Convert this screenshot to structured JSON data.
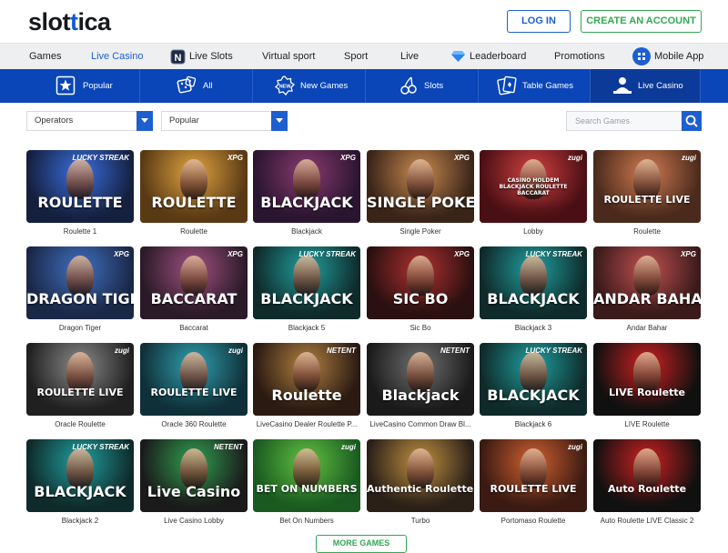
{
  "header": {
    "logo_prefix": "slot",
    "logo_accent": "t",
    "logo_suffix": "ica",
    "login_label": "LOG IN",
    "create_account_label": "CREATE AN ACCOUNT"
  },
  "main_nav": [
    {
      "label": "Games",
      "icon": null,
      "active": false
    },
    {
      "label": "Live Casino",
      "icon": null,
      "active": true
    },
    {
      "label": "Live Slots",
      "icon": "n-badge-icon",
      "active": false
    },
    {
      "label": "Virtual sport",
      "icon": null,
      "active": false
    },
    {
      "label": "Sport",
      "icon": null,
      "active": false
    },
    {
      "label": "Live",
      "icon": null,
      "active": false
    },
    {
      "label": "Leaderboard",
      "icon": "diamond-icon",
      "active": false
    },
    {
      "label": "Promotions",
      "icon": null,
      "active": false
    },
    {
      "label": "Mobile App",
      "icon": "app-icon",
      "active": false
    }
  ],
  "sub_nav": [
    {
      "label": "Popular",
      "icon": "star-icon",
      "active": false
    },
    {
      "label": "All",
      "icon": "dice-icon",
      "active": false
    },
    {
      "label": "New Games",
      "icon": "new-badge-icon",
      "active": false
    },
    {
      "label": "Slots",
      "icon": "cherries-icon",
      "active": false
    },
    {
      "label": "Table Games",
      "icon": "cards-icon",
      "active": false
    },
    {
      "label": "Live Casino",
      "icon": "dealer-icon",
      "active": true
    }
  ],
  "filters": {
    "operators_label": "Operators",
    "sort_label": "Popular",
    "search_placeholder": "Search Games"
  },
  "games": [
    {
      "name": "Roulette 1",
      "title": "ROULETTE",
      "badge": "LUCKY STREAK",
      "bg": "#15203f",
      "accent": "#3a6fe0"
    },
    {
      "name": "Roulette",
      "title": "ROULETTE",
      "badge": "XPG",
      "bg": "#5a3a14",
      "accent": "#e0a440"
    },
    {
      "name": "Blackjack",
      "title": "BLACKJACK",
      "badge": "XPG",
      "bg": "#2a1530",
      "accent": "#8a3a70"
    },
    {
      "name": "Single Poker",
      "title": "SINGLE POKER",
      "badge": "XPG",
      "bg": "#3a2418",
      "accent": "#c88a50"
    },
    {
      "name": "Lobby",
      "title": "CASINO HOLDEM BLACKJACK ROULETTE BACCARAT",
      "badge": "zugi",
      "bg": "#4a0f14",
      "accent": "#d04040"
    },
    {
      "name": "Roulette",
      "title": "ROULETTE LIVE",
      "badge": "zugi",
      "bg": "#4a2a1c",
      "accent": "#d07a50"
    },
    {
      "name": "Dragon Tiger",
      "title": "DRAGON TIGER",
      "badge": "XPG",
      "bg": "#1a2848",
      "accent": "#4070c0"
    },
    {
      "name": "Baccarat",
      "title": "BACCARAT",
      "badge": "XPG",
      "bg": "#2a1a28",
      "accent": "#a05080"
    },
    {
      "name": "Blackjack 5",
      "title": "BLACKJACK",
      "badge": "LUCKY STREAK",
      "bg": "#0f2a2a",
      "accent": "#20a0a0"
    },
    {
      "name": "Sic Bo",
      "title": "SIC BO",
      "badge": "XPG",
      "bg": "#2a1010",
      "accent": "#b03030"
    },
    {
      "name": "Blackjack 3",
      "title": "BLACKJACK",
      "badge": "LUCKY STREAK",
      "bg": "#0f2a2a",
      "accent": "#20a0a0"
    },
    {
      "name": "Andar Bahar",
      "title": "ANDAR BAHAR",
      "badge": "XPG",
      "bg": "#3a1a1a",
      "accent": "#c05050"
    },
    {
      "name": "Oracle Roulette",
      "title": "ROULETTE LIVE",
      "badge": "zugi",
      "bg": "#202020",
      "accent": "#8a8a8a"
    },
    {
      "name": "Oracle 360 Roulette",
      "title": "ROULETTE LIVE",
      "badge": "zugi",
      "bg": "#0f3038",
      "accent": "#30a0b0"
    },
    {
      "name": "LiveCasino Dealer Roulette P...",
      "title": "Roulette",
      "badge": "NETENT",
      "bg": "#2a1a12",
      "accent": "#b08040"
    },
    {
      "name": "LiveCasino Common Draw Bl...",
      "title": "Blackjack",
      "badge": "NETENT",
      "bg": "#1a1a1a",
      "accent": "#707070"
    },
    {
      "name": "Blackjack 6",
      "title": "BLACKJACK",
      "badge": "LUCKY STREAK",
      "bg": "#0f2a2a",
      "accent": "#20a0a0"
    },
    {
      "name": "LIVE Roulette",
      "title": "LIVE Roulette",
      "badge": "",
      "bg": "#101010",
      "accent": "#d02020"
    },
    {
      "name": "Blackjack 2",
      "title": "BLACKJACK",
      "badge": "LUCKY STREAK",
      "bg": "#0f2a2a",
      "accent": "#20a0a0"
    },
    {
      "name": "Live Casino Lobby",
      "title": "Live Casino",
      "badge": "NETENT",
      "bg": "#1a1a1a",
      "accent": "#30a050"
    },
    {
      "name": "Bet On Numbers",
      "title": "BET ON NUMBERS",
      "badge": "zugi",
      "bg": "#1a5a20",
      "accent": "#60c040"
    },
    {
      "name": "Turbo",
      "title": "Authentic Roulette TURBO",
      "badge": "",
      "bg": "#2a2018",
      "accent": "#c09040"
    },
    {
      "name": "Portomaso Roulette",
      "title": "ROULETTE LIVE",
      "badge": "zugi",
      "bg": "#3a1a12",
      "accent": "#d06030"
    },
    {
      "name": "Auto Roulette LIVE Classic 2",
      "title": "Auto Roulette",
      "badge": "",
      "bg": "#101010",
      "accent": "#d02020"
    }
  ],
  "more_games_label": "MORE GAMES",
  "colors": {
    "brand_blue": "#1e5fd0",
    "subnav_blue": "#0a46b8",
    "accent_green": "#33a852"
  }
}
